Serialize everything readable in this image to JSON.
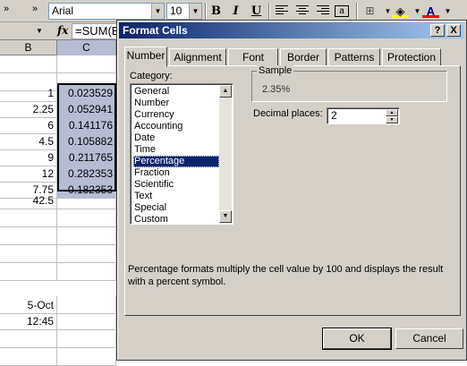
{
  "excel": {
    "font_name": "Arial",
    "font_size": "10",
    "formula": "=SUM(B",
    "columns": [
      "B",
      "C"
    ],
    "col_b": [
      "",
      "",
      "1",
      "2.25",
      "6",
      "4.5",
      "9",
      "12",
      "7.75",
      "42.5",
      "",
      "",
      "",
      "",
      "5-Oct",
      "12:45",
      "",
      ""
    ],
    "col_c": [
      "",
      "",
      "0.023529",
      "0.052941",
      "0.141176",
      "0.105882",
      "0.211765",
      "0.282353",
      "0.182353",
      "",
      "",
      "",
      "",
      "",
      "",
      "",
      "",
      ""
    ],
    "toolbar_icons": [
      "chevron-right-icon",
      "bold-icon",
      "italic-icon",
      "underline-icon",
      "align-left-icon",
      "align-center-icon",
      "align-right-icon",
      "merge-center-icon",
      "borders-icon",
      "fill-color-icon",
      "font-color-icon"
    ],
    "bold_label": "B",
    "italic_label": "I",
    "underline_label": "U",
    "font_color_label": "A",
    "fx_label": "fx"
  },
  "dialog": {
    "title": "Format Cells",
    "help_label": "?",
    "close_label": "X",
    "tabs": [
      "Number",
      "Alignment",
      "Font",
      "Border",
      "Patterns",
      "Protection"
    ],
    "active_tab": "Number",
    "category_label": "Category:",
    "categories": [
      "General",
      "Number",
      "Currency",
      "Accounting",
      "Date",
      "Time",
      "Percentage",
      "Fraction",
      "Scientific",
      "Text",
      "Special",
      "Custom"
    ],
    "selected_category": "Percentage",
    "sample_label": "Sample",
    "sample_value": "2.35%",
    "decimal_places_label": "Decimal places:",
    "decimal_places_value": "2",
    "description": "Percentage formats multiply the cell value by 100 and displays the result with a percent symbol.",
    "ok_label": "OK",
    "cancel_label": "Cancel"
  },
  "colors": {
    "dialog_bg": "#d4d0c8",
    "title_bar": "#0a246a",
    "selection": "#0a246a",
    "cell_selection": "#b6bdd2",
    "font_color_underline": "#ff0000",
    "fill_color_underline": "#ffff00"
  }
}
